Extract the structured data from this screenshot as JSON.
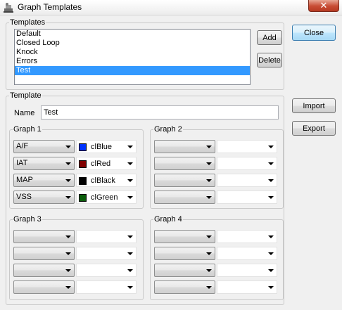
{
  "window": {
    "title": "Graph Templates",
    "close_glyph": "✕",
    "icon": "graph-templates-icon"
  },
  "templates_group": {
    "legend": "Templates",
    "items": [
      "Default",
      "Closed Loop",
      "Knock",
      "Errors",
      "Test"
    ],
    "selected_index": 4,
    "add_label": "Add",
    "delete_label": "Delete"
  },
  "template_group": {
    "legend": "Template",
    "name_label": "Name",
    "name_value": "Test",
    "graphs": [
      {
        "legend": "Graph 1",
        "rows": [
          {
            "channel": "A/F",
            "color_name": "clBlue",
            "color": "#0033ff"
          },
          {
            "channel": "IAT",
            "color_name": "clRed",
            "color": "#800000"
          },
          {
            "channel": "MAP",
            "color_name": "clBlack",
            "color": "#000000"
          },
          {
            "channel": "VSS",
            "color_name": "clGreen",
            "color": "#0b5d0b"
          }
        ]
      },
      {
        "legend": "Graph 2",
        "rows": [
          {},
          {},
          {},
          {}
        ]
      },
      {
        "legend": "Graph 3",
        "rows": [
          {},
          {},
          {},
          {}
        ]
      },
      {
        "legend": "Graph 4",
        "rows": [
          {},
          {},
          {},
          {}
        ]
      }
    ]
  },
  "buttons": {
    "close_label": "Close",
    "import_label": "Import",
    "export_label": "Export"
  }
}
